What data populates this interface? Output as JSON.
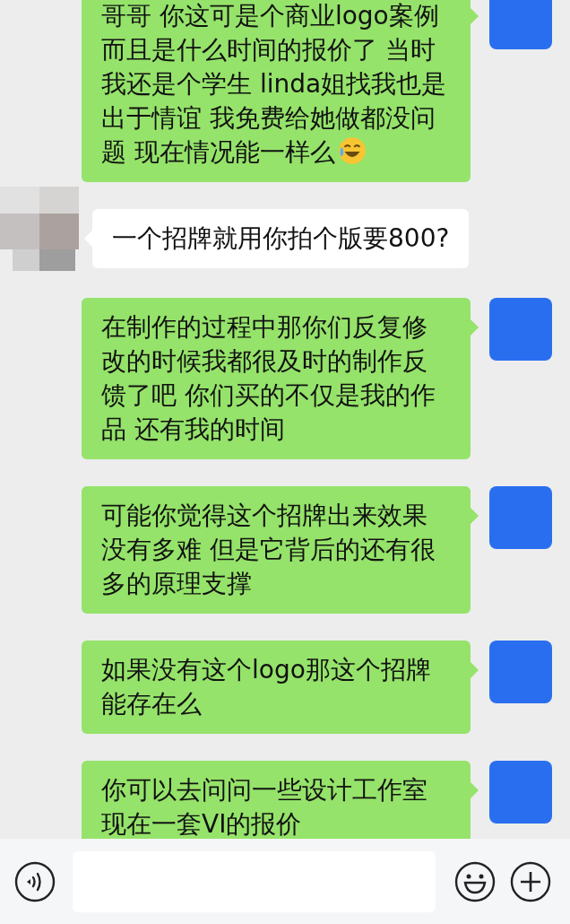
{
  "messages": [
    {
      "kind": "sent",
      "text": "哥哥 你这可是个商业logo案例而且是什么时间的报价了 当时我还是个学生 linda姐找我也是出于情谊 我免费给她做都没问题 现在情况能一样么",
      "emoji": true
    },
    {
      "kind": "received",
      "text": "一个招牌就用你拍个版要800?"
    },
    {
      "kind": "sent",
      "text": "在制作的过程中那你们反复修改的时候我都很及时的制作反馈了吧 你们买的不仅是我的作品 还有我的时间"
    },
    {
      "kind": "sent",
      "text": "可能你觉得这个招牌出来效果没有多难 但是它背后的还有很多的原理支撑"
    },
    {
      "kind": "sent",
      "text": "如果没有这个logo那这个招牌能存在么"
    },
    {
      "kind": "sent",
      "text": "你可以去问问一些设计工作室现在一套VI的报价"
    }
  ]
}
